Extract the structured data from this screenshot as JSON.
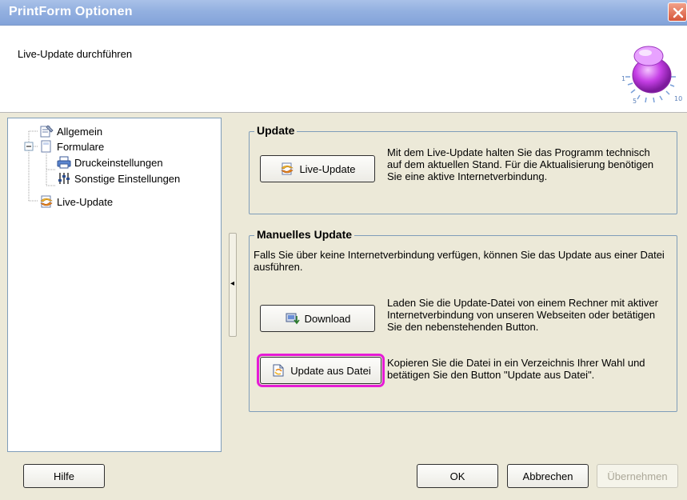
{
  "window": {
    "title": "PrintForm Optionen",
    "subtitle": "Live-Update durchführen"
  },
  "tree": {
    "items": [
      {
        "label": "Allgemein",
        "icon": "settings-page-icon"
      },
      {
        "label": "Formulare",
        "icon": "form-page-icon"
      },
      {
        "label": "Druckeinstellungen",
        "icon": "printer-icon"
      },
      {
        "label": "Sonstige Einstellungen",
        "icon": "sliders-icon"
      },
      {
        "label": "Live-Update",
        "icon": "live-update-icon"
      }
    ],
    "expander": "−"
  },
  "update_group": {
    "legend": "Update",
    "button_label": "Live-Update",
    "description": "Mit dem Live-Update halten Sie das Programm technisch auf dem aktuellen Stand. Für die Aktualisierung benötigen Sie eine aktive Internetverbindung."
  },
  "manual_group": {
    "legend": "Manuelles Update",
    "intro": "Falls Sie über keine Internetverbindung verfügen, können Sie das Update aus einer Datei ausführen.",
    "download_label": "Download",
    "download_desc": "Laden Sie die Update-Datei von einem Rechner mit aktiver Internetverbindung von unseren Webseiten oder betätigen Sie den nebenstehenden Button.",
    "file_label": "Update aus Datei",
    "file_desc": "Kopieren Sie die Datei in ein Verzeichnis Ihrer Wahl und betätigen Sie den Button \"Update aus Datei\"."
  },
  "footer": {
    "help": "Hilfe",
    "ok": "OK",
    "cancel": "Abbrechen",
    "apply": "Übernehmen"
  },
  "colors": {
    "titlebar": "#93b0e0",
    "dialog_bg": "#ece9d8",
    "highlight": "#e61bd6",
    "group_border": "#7f9db9"
  }
}
